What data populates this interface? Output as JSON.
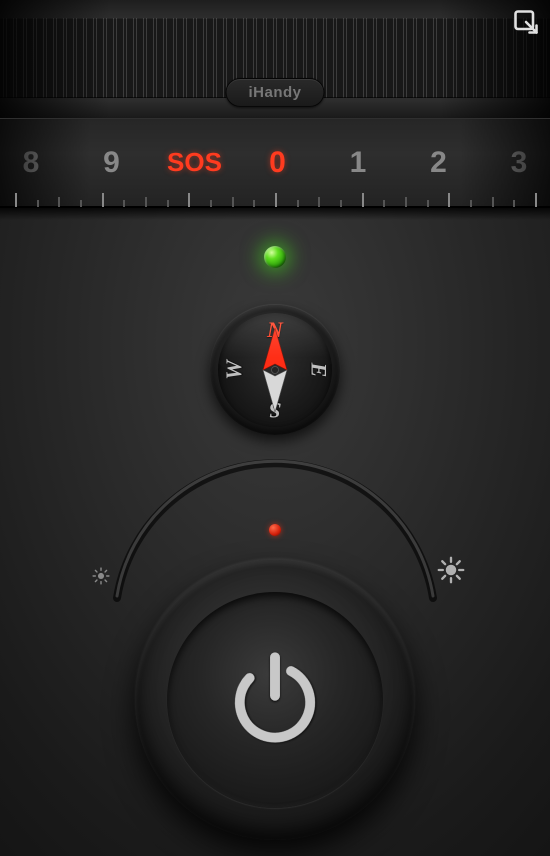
{
  "brand": "iHandy",
  "scale": {
    "items": [
      {
        "label": "8",
        "active": false
      },
      {
        "label": "9",
        "active": false
      },
      {
        "label": "SOS",
        "active": true
      },
      {
        "label": "0",
        "active": true
      },
      {
        "label": "1",
        "active": false
      },
      {
        "label": "2",
        "active": false
      },
      {
        "label": "3",
        "active": false
      }
    ]
  },
  "led": {
    "status": "on",
    "color": "#5fde1f"
  },
  "compass": {
    "n": "N",
    "e": "E",
    "s": "S",
    "w": "W",
    "heading_deg": 0
  },
  "dial": {
    "indicator_color": "#d41f0a"
  },
  "icons": {
    "corner": "expand-icon",
    "brightness_low": "brightness-low-icon",
    "brightness_high": "brightness-high-icon",
    "power": "power-icon"
  }
}
